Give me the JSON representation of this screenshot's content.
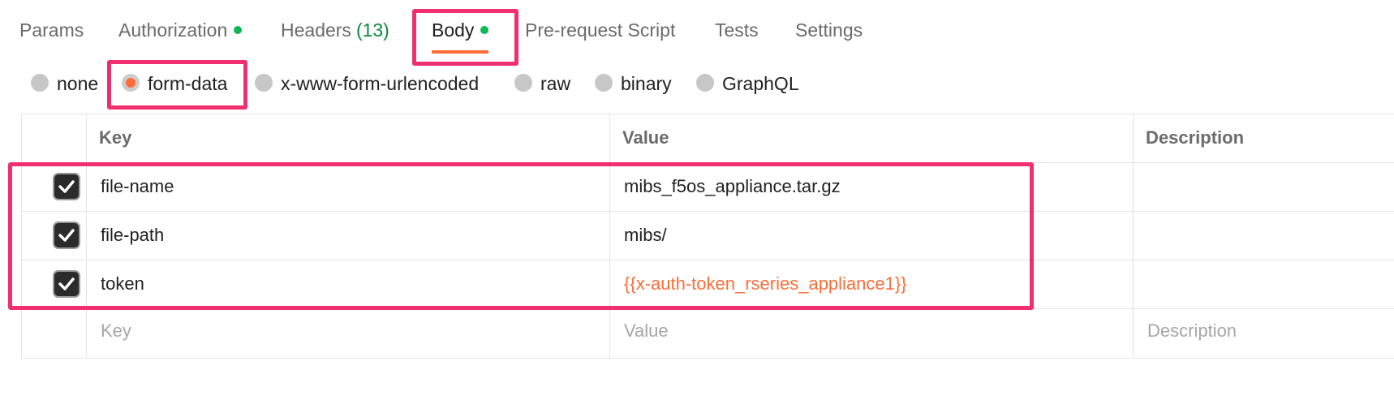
{
  "tabs": [
    {
      "label": "Params"
    },
    {
      "label": "Authorization",
      "has_dot": true
    },
    {
      "label": "Headers",
      "count": "(13)"
    },
    {
      "label": "Body",
      "has_dot": true,
      "active": true
    },
    {
      "label": "Pre-request Script"
    },
    {
      "label": "Tests"
    },
    {
      "label": "Settings"
    }
  ],
  "body_types": [
    {
      "label": "none",
      "checked": false
    },
    {
      "label": "form-data",
      "checked": true
    },
    {
      "label": "x-www-form-urlencoded",
      "checked": false
    },
    {
      "label": "raw",
      "checked": false
    },
    {
      "label": "binary",
      "checked": false
    },
    {
      "label": "GraphQL",
      "checked": false
    }
  ],
  "table": {
    "headers": {
      "key": "Key",
      "value": "Value",
      "description": "Description"
    },
    "rows": [
      {
        "checked": true,
        "key": "file-name",
        "value": "mibs_f5os_appliance.tar.gz",
        "description": ""
      },
      {
        "checked": true,
        "key": "file-path",
        "value": "mibs/",
        "description": ""
      },
      {
        "checked": true,
        "key": "token",
        "value": "{{x-auth-token_rseries_appliance1}}",
        "description": "",
        "value_is_variable": true
      }
    ],
    "placeholders": {
      "key": "Key",
      "value": "Value",
      "description": "Description"
    }
  },
  "colors": {
    "accent": "#ff6c37",
    "dot": "#10b853",
    "highlight": "#f0306e",
    "count": "#0b8a3e"
  }
}
